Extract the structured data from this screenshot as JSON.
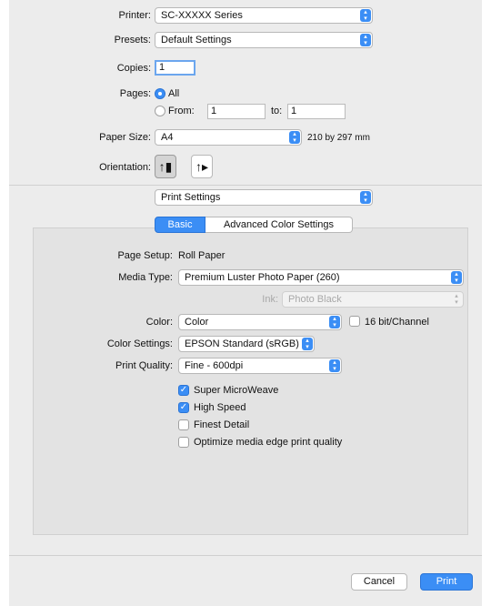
{
  "printer": {
    "label": "Printer:",
    "value": "SC-XXXXX Series"
  },
  "presets": {
    "label": "Presets:",
    "value": "Default Settings"
  },
  "copies": {
    "label": "Copies:",
    "value": "1"
  },
  "pages": {
    "label": "Pages:",
    "all_label": "All",
    "from_label": "From:",
    "from_value": "1",
    "to_label": "to:",
    "to_value": "1",
    "selected": "All"
  },
  "paper_size": {
    "label": "Paper Size:",
    "value": "A4",
    "dimensions": "210 by 297 mm"
  },
  "orientation": {
    "label": "Orientation:",
    "selected": "portrait"
  },
  "section_popup": {
    "value": "Print Settings"
  },
  "tabs": [
    {
      "label": "Basic",
      "selected": true
    },
    {
      "label": "Advanced Color Settings",
      "selected": false
    }
  ],
  "settings": {
    "page_setup": {
      "label": "Page Setup:",
      "value": "Roll Paper"
    },
    "media_type": {
      "label": "Media Type:",
      "value": "Premium Luster Photo Paper (260)"
    },
    "ink": {
      "label": "Ink:",
      "value": "Photo Black"
    },
    "color": {
      "label": "Color:",
      "value": "Color"
    },
    "bit16": {
      "label": "16 bit/Channel",
      "checked": false
    },
    "color_settings": {
      "label": "Color Settings:",
      "value": "EPSON Standard (sRGB)"
    },
    "print_quality": {
      "label": "Print Quality:",
      "value": "Fine - 600dpi"
    },
    "options": [
      {
        "label": "Super MicroWeave",
        "checked": true
      },
      {
        "label": "High Speed",
        "checked": true
      },
      {
        "label": "Finest Detail",
        "checked": false
      },
      {
        "label": "Optimize media edge print quality",
        "checked": false
      }
    ]
  },
  "buttons": {
    "cancel": "Cancel",
    "print": "Print"
  },
  "colors": {
    "accent": "#3b8ef5",
    "dialog_bg": "#ececec",
    "panel_bg": "#e3e3e3"
  },
  "icons": {
    "popup_arrow": "up-down-chevron",
    "check": "checkmark"
  }
}
